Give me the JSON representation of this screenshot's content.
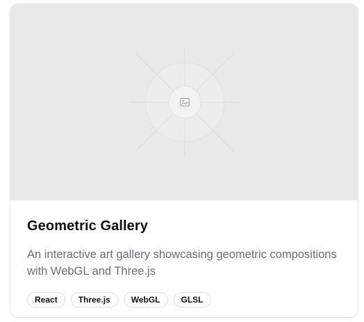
{
  "card": {
    "image_alt_icon": "image-placeholder-icon",
    "title": "Geometric Gallery",
    "description": "An interactive art gallery showcasing geometric compositions with WebGL and Three.js",
    "tags": [
      "React",
      "Three.js",
      "WebGL",
      "GLSL"
    ]
  },
  "colors": {
    "placeholder_bg": "#e9e9e9",
    "title": "#0f0f0f",
    "description": "#6b6b73",
    "tag_border": "#dedede"
  }
}
